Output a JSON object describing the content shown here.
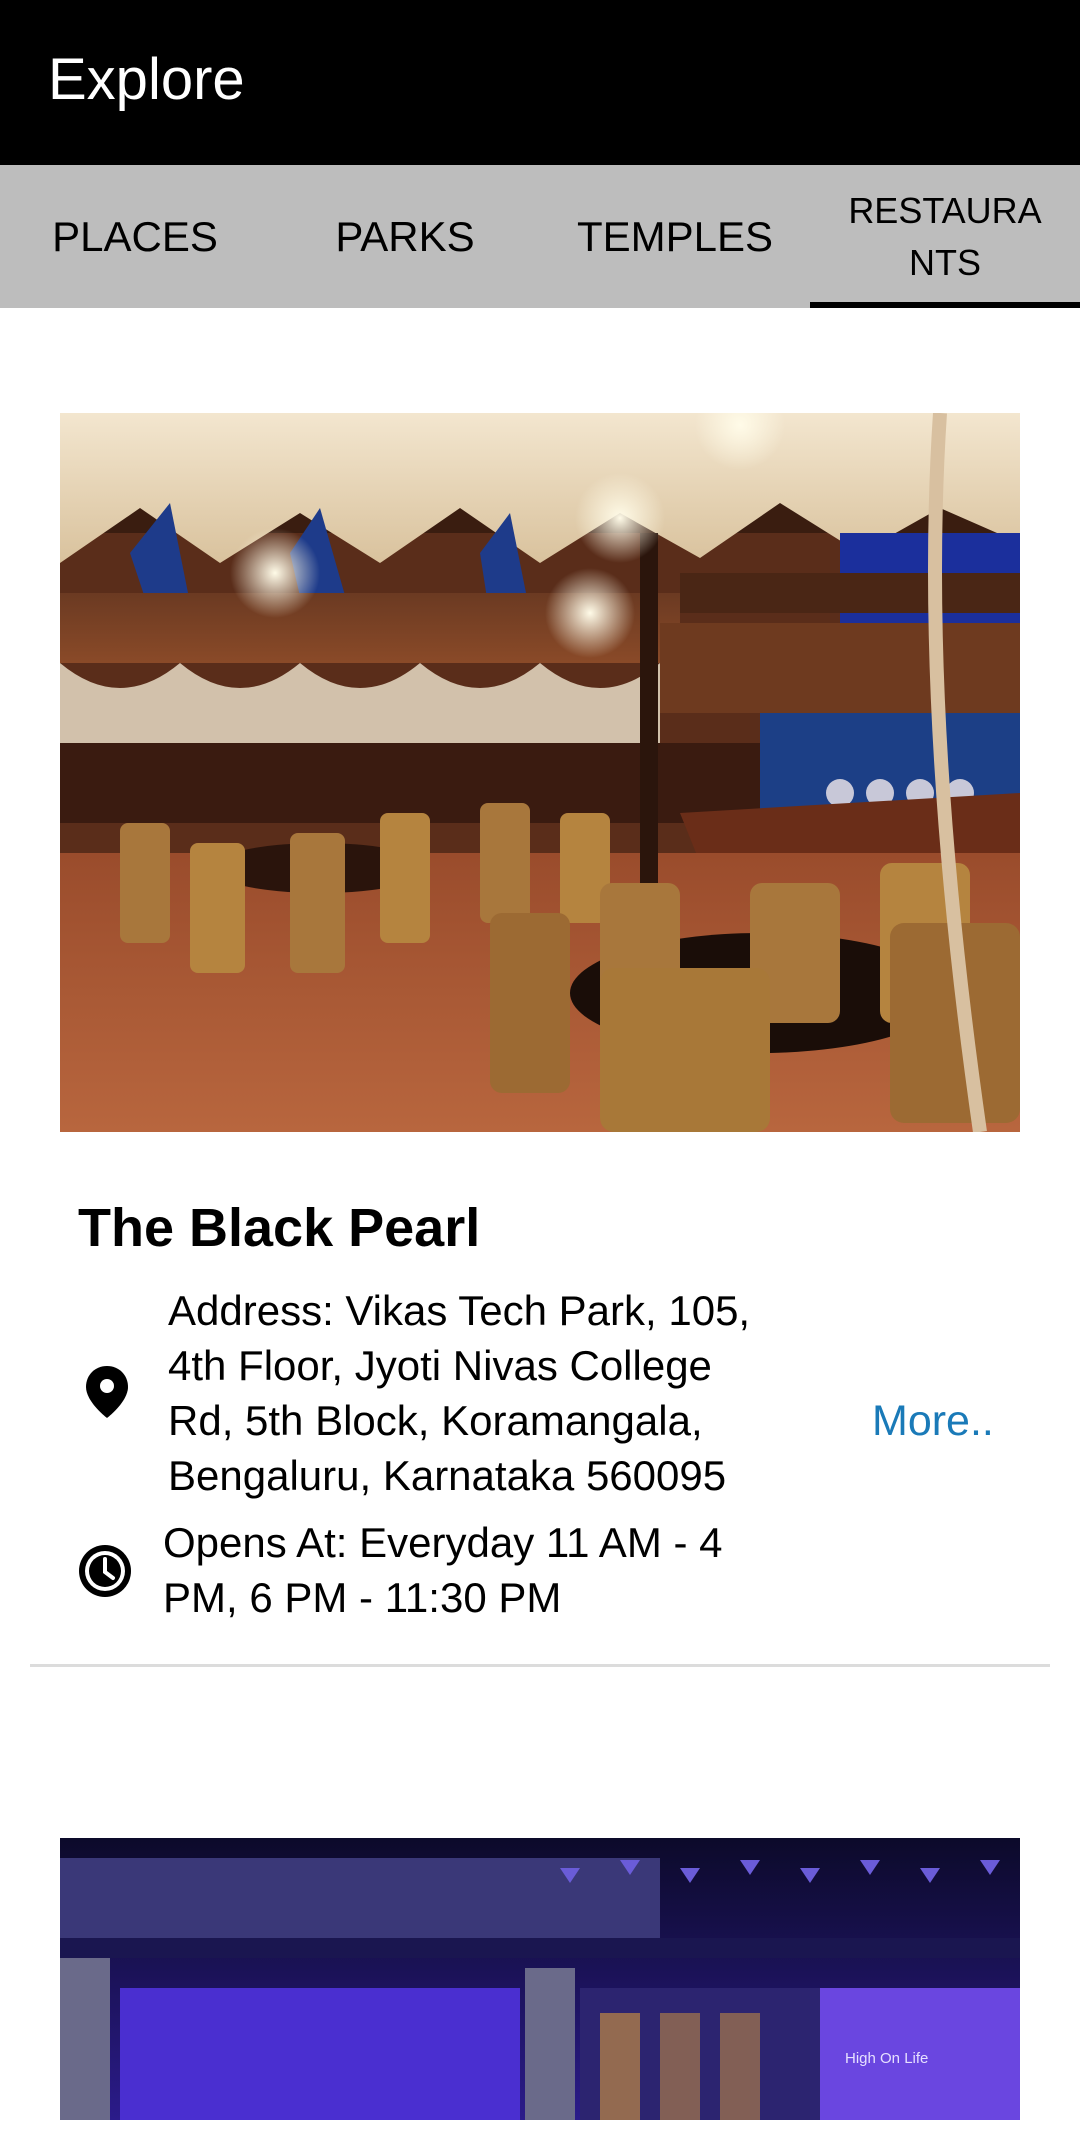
{
  "appbar": {
    "title": "Explore"
  },
  "tabs": [
    {
      "label": "PLACES",
      "active": false
    },
    {
      "label": "PARKS",
      "active": false
    },
    {
      "label": "TEMPLES",
      "active": false
    },
    {
      "label": "RESTAURANTS",
      "active": true
    }
  ],
  "restaurants": [
    {
      "name": "The Black Pearl",
      "address": "Address: Vikas Tech Park, 105, 4th Floor, Jyoti Nivas College Rd, 5th Block, Koramangala, Bengaluru, Karnataka 560095",
      "hours": "Opens At: Everyday 11 AM - 4 PM, 6 PM - 11:30 PM",
      "more_label": "More..",
      "pin_icon": "location-pin-icon",
      "clock_icon": "clock-icon"
    },
    {
      "photo_sign": "High On Life"
    }
  ],
  "colors": {
    "appbar_bg": "#000000",
    "tabbar_bg": "#bdbdbd",
    "link": "#1a7ab8",
    "divider": "#dcdcdc"
  }
}
